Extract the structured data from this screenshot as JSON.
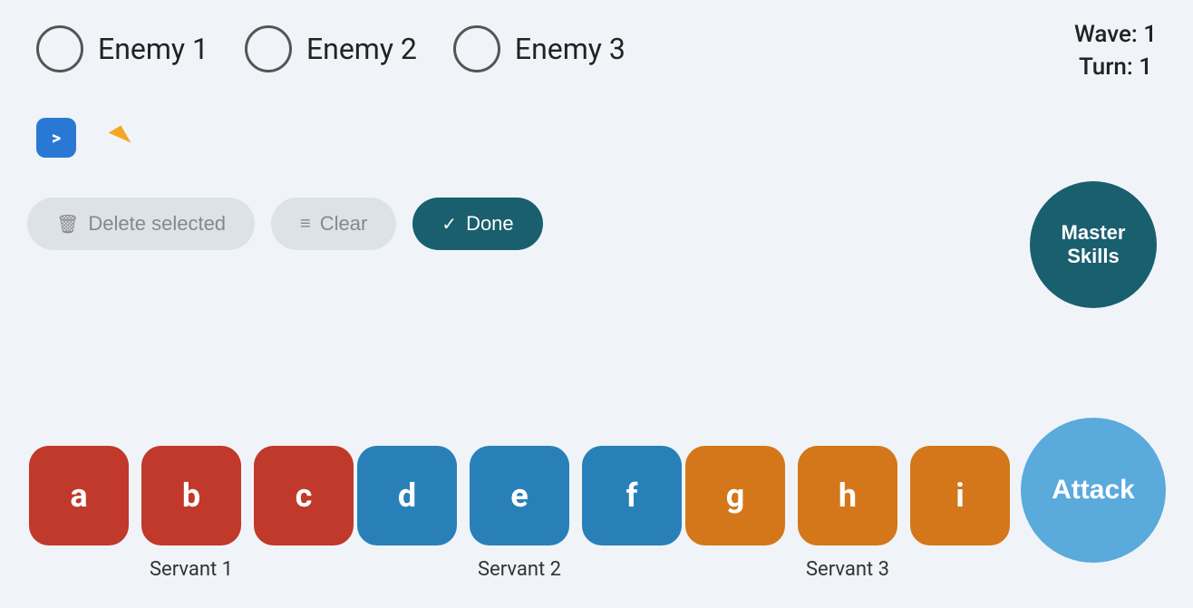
{
  "enemies": [
    {
      "label": "Enemy 1"
    },
    {
      "label": "Enemy 2"
    },
    {
      "label": "Enemy 3"
    }
  ],
  "wave": {
    "wave_label": "Wave: 1",
    "turn_label": "Turn: 1"
  },
  "terminal": {
    "icon_text": ">"
  },
  "actions": {
    "delete_label": "Delete selected",
    "clear_label": "Clear",
    "done_label": "Done"
  },
  "master_skills": {
    "label": "Master\nSkills"
  },
  "servants": [
    {
      "label": "Servant 1",
      "color": "red",
      "cards": [
        "a",
        "b",
        "c"
      ]
    },
    {
      "label": "Servant 2",
      "color": "blue",
      "cards": [
        "d",
        "e",
        "f"
      ]
    },
    {
      "label": "Servant 3",
      "color": "orange",
      "cards": [
        "g",
        "h",
        "i"
      ]
    }
  ],
  "attack": {
    "label": "Attack"
  }
}
